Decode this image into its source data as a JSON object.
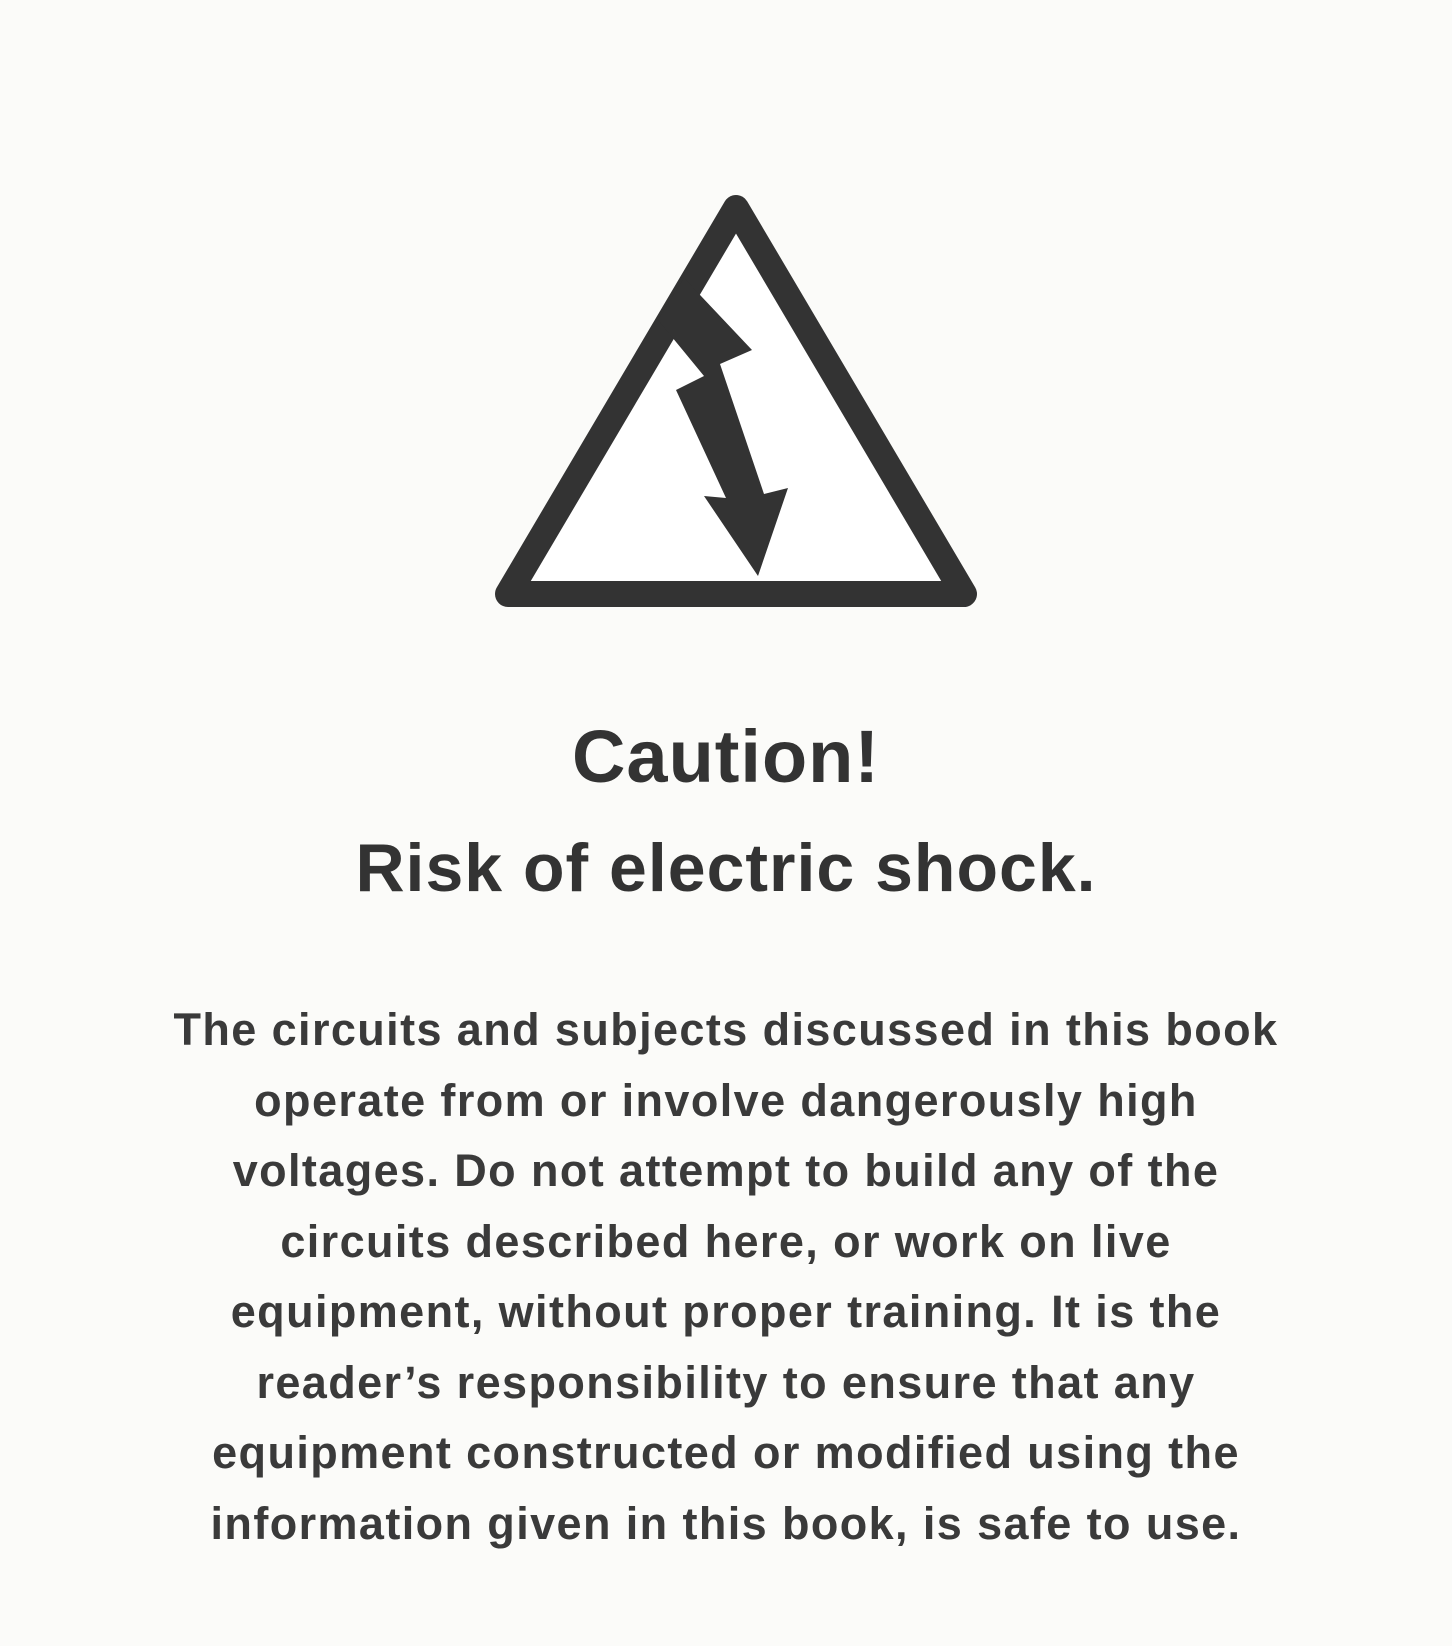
{
  "sign": {
    "icon": "high-voltage-warning-icon",
    "stroke_color": "#333333",
    "fill_color": "#ffffff"
  },
  "heading": {
    "title": "Caution!",
    "subtitle": "Risk of electric shock."
  },
  "notice": {
    "lines": [
      "The circuits and subjects discussed in this book",
      "operate from or involve dangerously high",
      "voltages. Do not attempt to build any of the",
      "circuits described here, or work on live",
      "equipment, without proper training. It is the",
      "reader’s responsibility to ensure that any",
      "equipment constructed or modified using the",
      "information given in this book, is safe to use."
    ]
  }
}
